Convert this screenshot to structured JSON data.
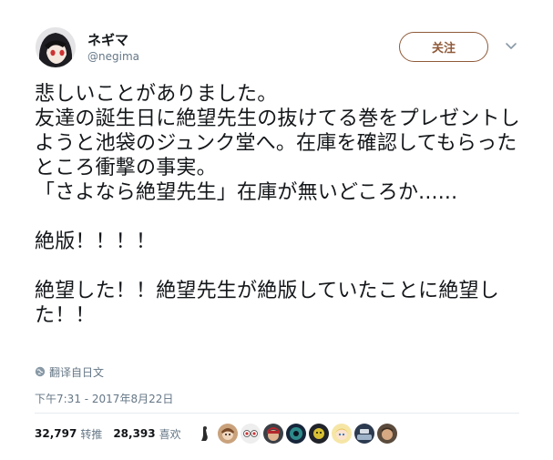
{
  "user": {
    "display_name": "ネギマ",
    "handle": "@negima",
    "avatar_icon": "avatar-anime-girl"
  },
  "header": {
    "follow_label": "关注",
    "menu_icon": "chevron-down-icon"
  },
  "tweet": {
    "text": "悲しいことがありました。\n友達の誕生日に絶望先生の抜けてる巻をプレゼントしようと池袋のジュンク堂へ。在庫を確認してもらったところ衝撃の事実。\n「さよなら絶望先生」在庫が無いどころか......\n\n絶版！！！！\n\n絶望した！！絶望先生が絶版していたことに絶望した！！",
    "translate_label": "翻译自日文",
    "timestamp": "下午7:31 - 2017年8月22日"
  },
  "stats": {
    "retweets_count": "32,797",
    "retweets_label": "转推",
    "likes_count": "28,393",
    "likes_label": "喜欢"
  },
  "likers": [
    "liker-avatar-1",
    "liker-avatar-2",
    "liker-avatar-3",
    "liker-avatar-4",
    "liker-avatar-5",
    "liker-avatar-6",
    "liker-avatar-7",
    "liker-avatar-8",
    "liker-avatar-9",
    "liker-avatar-10"
  ],
  "colors": {
    "accent": "#8f5a39",
    "text": "#14171a",
    "muted": "#657786"
  }
}
